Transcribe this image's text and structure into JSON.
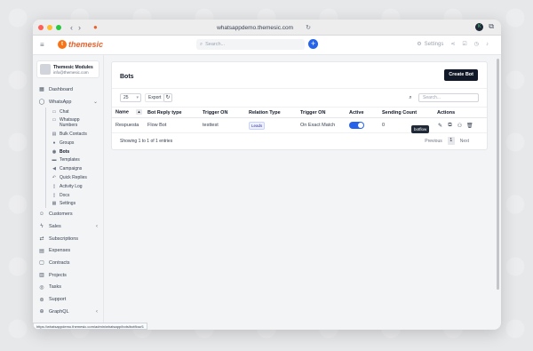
{
  "browser": {
    "url": "whatsappdemo.themesic.com",
    "status_url": "https://whatsappdemo.themesic.com/admin/whatsapp/bots/botflow/1"
  },
  "app": {
    "brand": "themesic",
    "search_placeholder": "Search...",
    "settings_label": "Settings"
  },
  "user": {
    "name": "Themesic Modules",
    "email": "info@themesic.com"
  },
  "sidebar": {
    "top_items": [
      {
        "label": "Dashboard",
        "icon": "dashboard-icon"
      },
      {
        "label": "WhatsApp",
        "icon": "whatsapp-icon"
      }
    ],
    "whatsapp_sub": [
      {
        "label": "Chat",
        "icon": "chat-icon"
      },
      {
        "label": "Whatsapp Numbers",
        "icon": "phone-icon"
      },
      {
        "label": "Bulk Contacts",
        "icon": "contacts-icon"
      },
      {
        "label": "Groups",
        "icon": "group-icon"
      },
      {
        "label": "Bots",
        "icon": "bot-icon"
      },
      {
        "label": "Templates",
        "icon": "template-icon"
      },
      {
        "label": "Campaigns",
        "icon": "megaphone-icon"
      },
      {
        "label": "Quick Replies",
        "icon": "reply-icon"
      },
      {
        "label": "Activity Log",
        "icon": "log-icon"
      },
      {
        "label": "Docs",
        "icon": "docs-icon"
      },
      {
        "label": "Settings",
        "icon": "settings-icon"
      }
    ],
    "bottom_items": [
      {
        "label": "Customers",
        "icon": "customers-icon"
      },
      {
        "label": "Sales",
        "icon": "sales-icon"
      },
      {
        "label": "Subscriptions",
        "icon": "subscriptions-icon"
      },
      {
        "label": "Expenses",
        "icon": "expenses-icon"
      },
      {
        "label": "Contracts",
        "icon": "contracts-icon"
      },
      {
        "label": "Projects",
        "icon": "projects-icon"
      },
      {
        "label": "Tasks",
        "icon": "tasks-icon"
      },
      {
        "label": "Support",
        "icon": "support-icon"
      },
      {
        "label": "GraphQL",
        "icon": "graphql-icon"
      }
    ]
  },
  "page": {
    "title": "Bots",
    "create_button": "Create Bot",
    "page_size": "25",
    "export_label": "Export",
    "search_placeholder": "Search...",
    "columns": [
      "Name",
      "Bot Reply type",
      "Trigger ON",
      "Relation Type",
      "Trigger ON",
      "Active",
      "Sending Count",
      "Actions"
    ],
    "rows": [
      {
        "name": "Respuesta",
        "reply_type": "Flow Bot",
        "trigger": "testtest",
        "relation": "Leads",
        "trigger_on": "On Exact Match",
        "active": true,
        "count": "0"
      }
    ],
    "tooltip": "botflow",
    "showing": "Showing 1 to 1 of 1 entries",
    "pager": {
      "previous": "Previous",
      "current": "1",
      "next": "Next"
    }
  }
}
